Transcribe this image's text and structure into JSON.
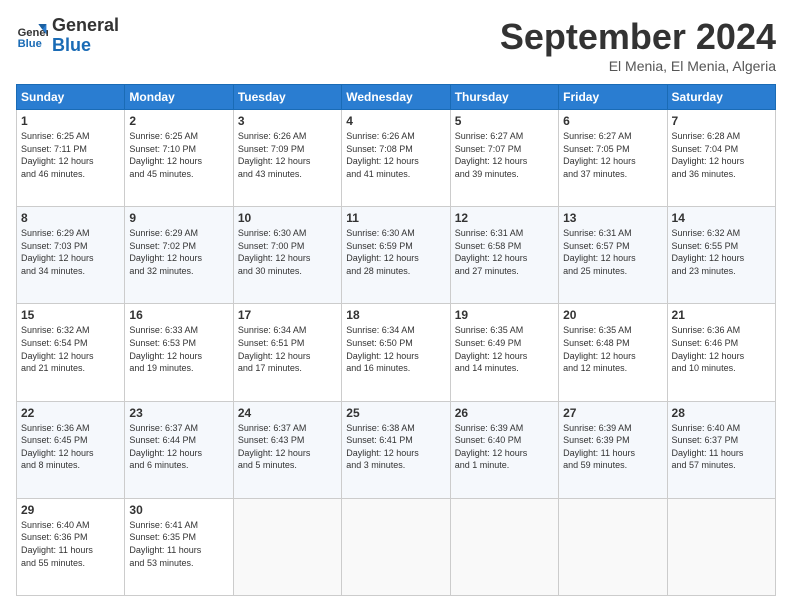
{
  "header": {
    "logo_line1": "General",
    "logo_line2": "Blue",
    "month": "September 2024",
    "location": "El Menia, El Menia, Algeria"
  },
  "weekdays": [
    "Sunday",
    "Monday",
    "Tuesday",
    "Wednesday",
    "Thursday",
    "Friday",
    "Saturday"
  ],
  "weeks": [
    [
      {
        "day": "1",
        "info": "Sunrise: 6:25 AM\nSunset: 7:11 PM\nDaylight: 12 hours\nand 46 minutes."
      },
      {
        "day": "2",
        "info": "Sunrise: 6:25 AM\nSunset: 7:10 PM\nDaylight: 12 hours\nand 45 minutes."
      },
      {
        "day": "3",
        "info": "Sunrise: 6:26 AM\nSunset: 7:09 PM\nDaylight: 12 hours\nand 43 minutes."
      },
      {
        "day": "4",
        "info": "Sunrise: 6:26 AM\nSunset: 7:08 PM\nDaylight: 12 hours\nand 41 minutes."
      },
      {
        "day": "5",
        "info": "Sunrise: 6:27 AM\nSunset: 7:07 PM\nDaylight: 12 hours\nand 39 minutes."
      },
      {
        "day": "6",
        "info": "Sunrise: 6:27 AM\nSunset: 7:05 PM\nDaylight: 12 hours\nand 37 minutes."
      },
      {
        "day": "7",
        "info": "Sunrise: 6:28 AM\nSunset: 7:04 PM\nDaylight: 12 hours\nand 36 minutes."
      }
    ],
    [
      {
        "day": "8",
        "info": "Sunrise: 6:29 AM\nSunset: 7:03 PM\nDaylight: 12 hours\nand 34 minutes."
      },
      {
        "day": "9",
        "info": "Sunrise: 6:29 AM\nSunset: 7:02 PM\nDaylight: 12 hours\nand 32 minutes."
      },
      {
        "day": "10",
        "info": "Sunrise: 6:30 AM\nSunset: 7:00 PM\nDaylight: 12 hours\nand 30 minutes."
      },
      {
        "day": "11",
        "info": "Sunrise: 6:30 AM\nSunset: 6:59 PM\nDaylight: 12 hours\nand 28 minutes."
      },
      {
        "day": "12",
        "info": "Sunrise: 6:31 AM\nSunset: 6:58 PM\nDaylight: 12 hours\nand 27 minutes."
      },
      {
        "day": "13",
        "info": "Sunrise: 6:31 AM\nSunset: 6:57 PM\nDaylight: 12 hours\nand 25 minutes."
      },
      {
        "day": "14",
        "info": "Sunrise: 6:32 AM\nSunset: 6:55 PM\nDaylight: 12 hours\nand 23 minutes."
      }
    ],
    [
      {
        "day": "15",
        "info": "Sunrise: 6:32 AM\nSunset: 6:54 PM\nDaylight: 12 hours\nand 21 minutes."
      },
      {
        "day": "16",
        "info": "Sunrise: 6:33 AM\nSunset: 6:53 PM\nDaylight: 12 hours\nand 19 minutes."
      },
      {
        "day": "17",
        "info": "Sunrise: 6:34 AM\nSunset: 6:51 PM\nDaylight: 12 hours\nand 17 minutes."
      },
      {
        "day": "18",
        "info": "Sunrise: 6:34 AM\nSunset: 6:50 PM\nDaylight: 12 hours\nand 16 minutes."
      },
      {
        "day": "19",
        "info": "Sunrise: 6:35 AM\nSunset: 6:49 PM\nDaylight: 12 hours\nand 14 minutes."
      },
      {
        "day": "20",
        "info": "Sunrise: 6:35 AM\nSunset: 6:48 PM\nDaylight: 12 hours\nand 12 minutes."
      },
      {
        "day": "21",
        "info": "Sunrise: 6:36 AM\nSunset: 6:46 PM\nDaylight: 12 hours\nand 10 minutes."
      }
    ],
    [
      {
        "day": "22",
        "info": "Sunrise: 6:36 AM\nSunset: 6:45 PM\nDaylight: 12 hours\nand 8 minutes."
      },
      {
        "day": "23",
        "info": "Sunrise: 6:37 AM\nSunset: 6:44 PM\nDaylight: 12 hours\nand 6 minutes."
      },
      {
        "day": "24",
        "info": "Sunrise: 6:37 AM\nSunset: 6:43 PM\nDaylight: 12 hours\nand 5 minutes."
      },
      {
        "day": "25",
        "info": "Sunrise: 6:38 AM\nSunset: 6:41 PM\nDaylight: 12 hours\nand 3 minutes."
      },
      {
        "day": "26",
        "info": "Sunrise: 6:39 AM\nSunset: 6:40 PM\nDaylight: 12 hours\nand 1 minute."
      },
      {
        "day": "27",
        "info": "Sunrise: 6:39 AM\nSunset: 6:39 PM\nDaylight: 11 hours\nand 59 minutes."
      },
      {
        "day": "28",
        "info": "Sunrise: 6:40 AM\nSunset: 6:37 PM\nDaylight: 11 hours\nand 57 minutes."
      }
    ],
    [
      {
        "day": "29",
        "info": "Sunrise: 6:40 AM\nSunset: 6:36 PM\nDaylight: 11 hours\nand 55 minutes."
      },
      {
        "day": "30",
        "info": "Sunrise: 6:41 AM\nSunset: 6:35 PM\nDaylight: 11 hours\nand 53 minutes."
      },
      null,
      null,
      null,
      null,
      null
    ]
  ]
}
